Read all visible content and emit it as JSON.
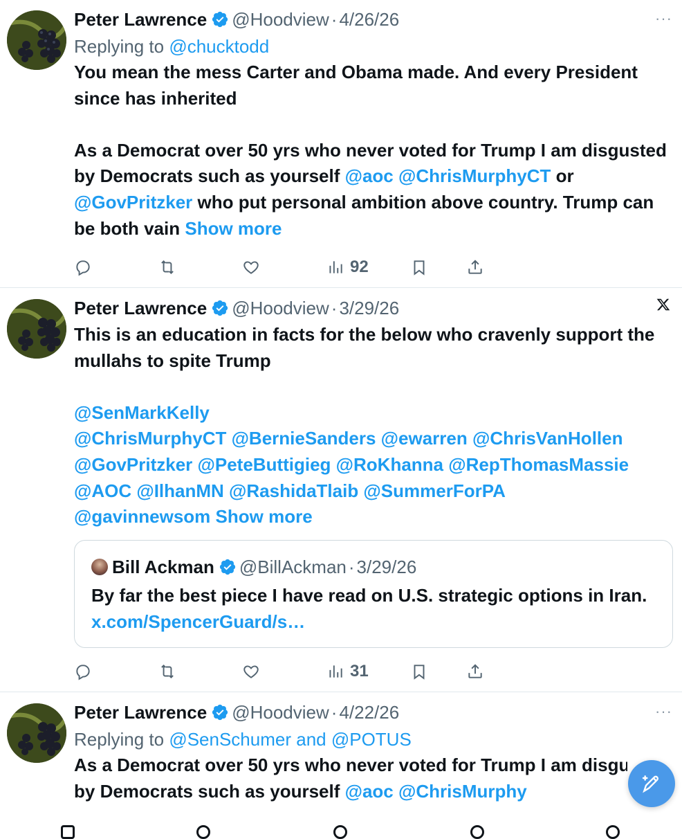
{
  "tweets": [
    {
      "name": "Peter Lawrence",
      "handle": "@Hoodview",
      "dot": "·",
      "date": "4/26/26",
      "replying_prefix": "Replying to",
      "replying_to": "@chucktodd",
      "para1": "You mean the mess Carter and Obama made. And every President since has inherited",
      "para2_a": "As a Democrat over 50 yrs who never voted for Trump I am disgusted by Democrats such as yourself ",
      "mention_aoc": "@aoc",
      "mention_murphy": "@ChrisMurphyCT",
      "word_or": "or",
      "mention_pritzker": "@GovPritzker",
      "para2_b": "who put personal ambition above country. Trump can be both vain",
      "show_more": "Show more",
      "views": "92"
    },
    {
      "name": "Peter Lawrence",
      "handle": "@Hoodview",
      "dot": "·",
      "date": "3/29/26",
      "para1": "This is an education in facts for the below who cravenly support the mullahs to spite Trump",
      "mentions_line1": "@SenMarkKelly",
      "mentions_line2": "@ChrisMurphyCT @BernieSanders @ewarren @ChrisVanHollen",
      "mentions_line3": "@GovPritzker @PeteButtigieg @RoKhanna @RepThomasMassie",
      "mentions_line4": "@AOC @IlhanMN @RashidaTlaib @SummerForPA",
      "mentions_line5": "@gavinnewsom",
      "show_more": "Show more",
      "quote": {
        "name": "Bill Ackman",
        "handle": "@BillAckman",
        "dot": "·",
        "date": "3/29/26",
        "text": "By far the best piece I have read on U.S. strategic options in Iran.",
        "link": "x.com/SpencerGuard/s…"
      },
      "views": "31"
    },
    {
      "name": "Peter Lawrence",
      "handle": "@Hoodview",
      "dot": "·",
      "date": "4/22/26",
      "replying_prefix": "Replying to",
      "replying_to": "@SenSchumer and @POTUS",
      "para1": "As a Democrat over 50 yrs who never voted for Trump I am disgusted by Democrats such as yourself ",
      "mention_aoc": "@aoc",
      "mention_murphy": "@ChrisMurphy"
    }
  ],
  "more_label": "···",
  "colors": {
    "link": "#1d9bf0",
    "secondary": "#536471",
    "verified": "#1d9bf0",
    "fab": "#4a99e9"
  }
}
